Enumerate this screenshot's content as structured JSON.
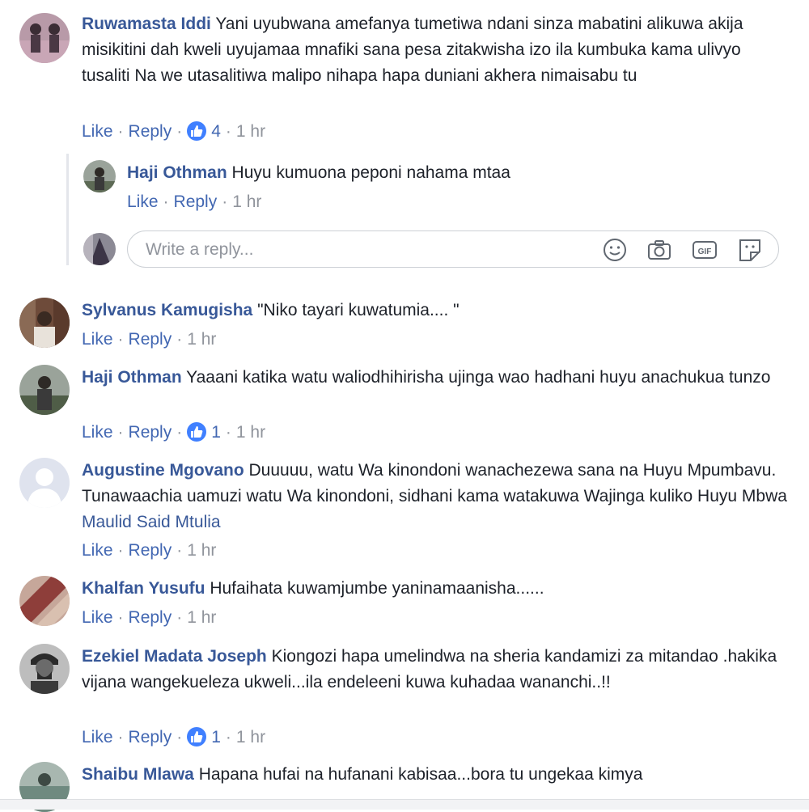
{
  "actions": {
    "like": "Like",
    "reply": "Reply",
    "dot": "·"
  },
  "comments": [
    {
      "author": "Ruwamasta Iddi",
      "text": "Yani uyubwana amefanya tumetiwa ndani sinza mabatini alikuwa akija misikitini dah kweli uyujamaa mnafiki sana pesa zitakwisha izo ila kumbuka kama ulivyo tusaliti Na we utasalitiwa malipo nihapa hapa duniani akhera nimaisabu tu",
      "likes": "4",
      "time": "1 hr"
    },
    {
      "author": "Sylvanus Kamugisha",
      "text": "\"Niko tayari kuwatumia.... \"",
      "time": "1 hr"
    },
    {
      "author": "Haji Othman",
      "text": "Yaaani katika watu waliodhihirisha ujinga wao hadhani huyu anachukua tunzo",
      "likes": "1",
      "time": "1 hr"
    },
    {
      "author": "Augustine Mgovano",
      "text": "Duuuuu, watu Wa kinondoni wanachezewa sana na Huyu Mpumbavu. Tunawaachia uamuzi watu Wa kinondoni, sidhani kama watakuwa Wajinga kuliko Huyu Mbwa",
      "mention": "Maulid Said Mtulia",
      "time": "1 hr"
    },
    {
      "author": "Khalfan Yusufu",
      "text": "Hufaihata kuwamjumbe yaninamaanisha......",
      "time": "1 hr"
    },
    {
      "author": "Ezekiel Madata Joseph",
      "text": "Kiongozi hapa umelindwa na sheria kandamizi za mitandao .hakika vijana wangekueleza ukweli...ila endeleeni kuwa kuhadaa wananchi..!!",
      "likes": "1",
      "time": "1 hr"
    },
    {
      "author": "Shaibu Mlawa",
      "text": "Hapana hufai na hufanani kabisaa...bora tu ungekaa kimya"
    }
  ],
  "reply": {
    "author": "Haji Othman",
    "text": "Huyu kumuona peponi nahama mtaa",
    "time": "1 hr"
  },
  "reply_input": {
    "placeholder": "Write a reply..."
  },
  "reply_icons": [
    "emoji-icon",
    "camera-icon",
    "gif-icon",
    "sticker-icon"
  ],
  "colors": {
    "link": "#385898",
    "action": "#4267b2",
    "muted": "#90949c",
    "like_badge": "#4080ff"
  }
}
